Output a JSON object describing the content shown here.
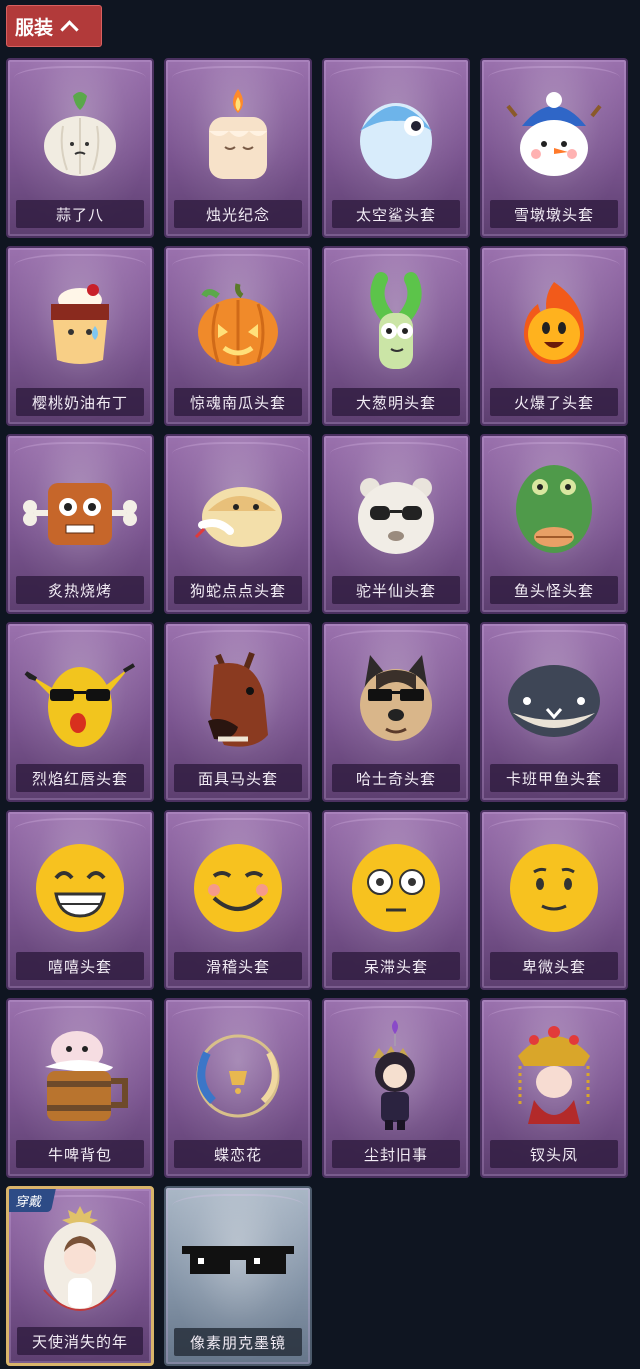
{
  "header": {
    "category_label": "服装"
  },
  "items": [
    {
      "label": "蒜了八",
      "icon": "garlic-icon",
      "variant": "purple"
    },
    {
      "label": "烛光纪念",
      "icon": "candle-icon",
      "variant": "purple"
    },
    {
      "label": "太空鲨头套",
      "icon": "shark-icon",
      "variant": "purple"
    },
    {
      "label": "雪墩墩头套",
      "icon": "snowman-icon",
      "variant": "purple"
    },
    {
      "label": "樱桃奶油布丁",
      "icon": "pudding-icon",
      "variant": "purple"
    },
    {
      "label": "惊魂南瓜头套",
      "icon": "pumpkin-icon",
      "variant": "purple"
    },
    {
      "label": "大葱明头套",
      "icon": "scallion-icon",
      "variant": "purple"
    },
    {
      "label": "火爆了头套",
      "icon": "fireball-icon",
      "variant": "purple"
    },
    {
      "label": "炙热烧烤",
      "icon": "bbq-icon",
      "variant": "purple"
    },
    {
      "label": "狗蛇点点头套",
      "icon": "snake-icon",
      "variant": "purple"
    },
    {
      "label": "驼半仙头套",
      "icon": "alpaca-icon",
      "variant": "purple"
    },
    {
      "label": "鱼头怪头套",
      "icon": "fish-head-icon",
      "variant": "purple"
    },
    {
      "label": "烈焰红唇头套",
      "icon": "pikachu-mask-icon",
      "variant": "purple"
    },
    {
      "label": "面具马头套",
      "icon": "horse-mask-icon",
      "variant": "purple"
    },
    {
      "label": "哈士奇头套",
      "icon": "husky-icon",
      "variant": "purple"
    },
    {
      "label": "卡班甲鱼头套",
      "icon": "turtle-icon",
      "variant": "purple"
    },
    {
      "label": "嘻嘻头套",
      "icon": "grin-emoji-icon",
      "variant": "purple"
    },
    {
      "label": "滑稽头套",
      "icon": "smirk-emoji-icon",
      "variant": "purple"
    },
    {
      "label": "呆滞头套",
      "icon": "stare-emoji-icon",
      "variant": "purple"
    },
    {
      "label": "卑微头套",
      "icon": "humble-emoji-icon",
      "variant": "purple"
    },
    {
      "label": "牛啤背包",
      "icon": "cow-beer-icon",
      "variant": "purple"
    },
    {
      "label": "蝶恋花",
      "icon": "wreath-icon",
      "variant": "purple"
    },
    {
      "label": "尘封旧事",
      "icon": "prince-icon",
      "variant": "purple"
    },
    {
      "label": "钗头凤",
      "icon": "phoenix-crown-icon",
      "variant": "purple"
    },
    {
      "label": "天使消失的年",
      "icon": "angel-icon",
      "variant": "purple",
      "badge": "穿戴"
    },
    {
      "label": "像素朋克墨镜",
      "icon": "pixel-sunglasses-icon",
      "variant": "grey"
    }
  ]
}
